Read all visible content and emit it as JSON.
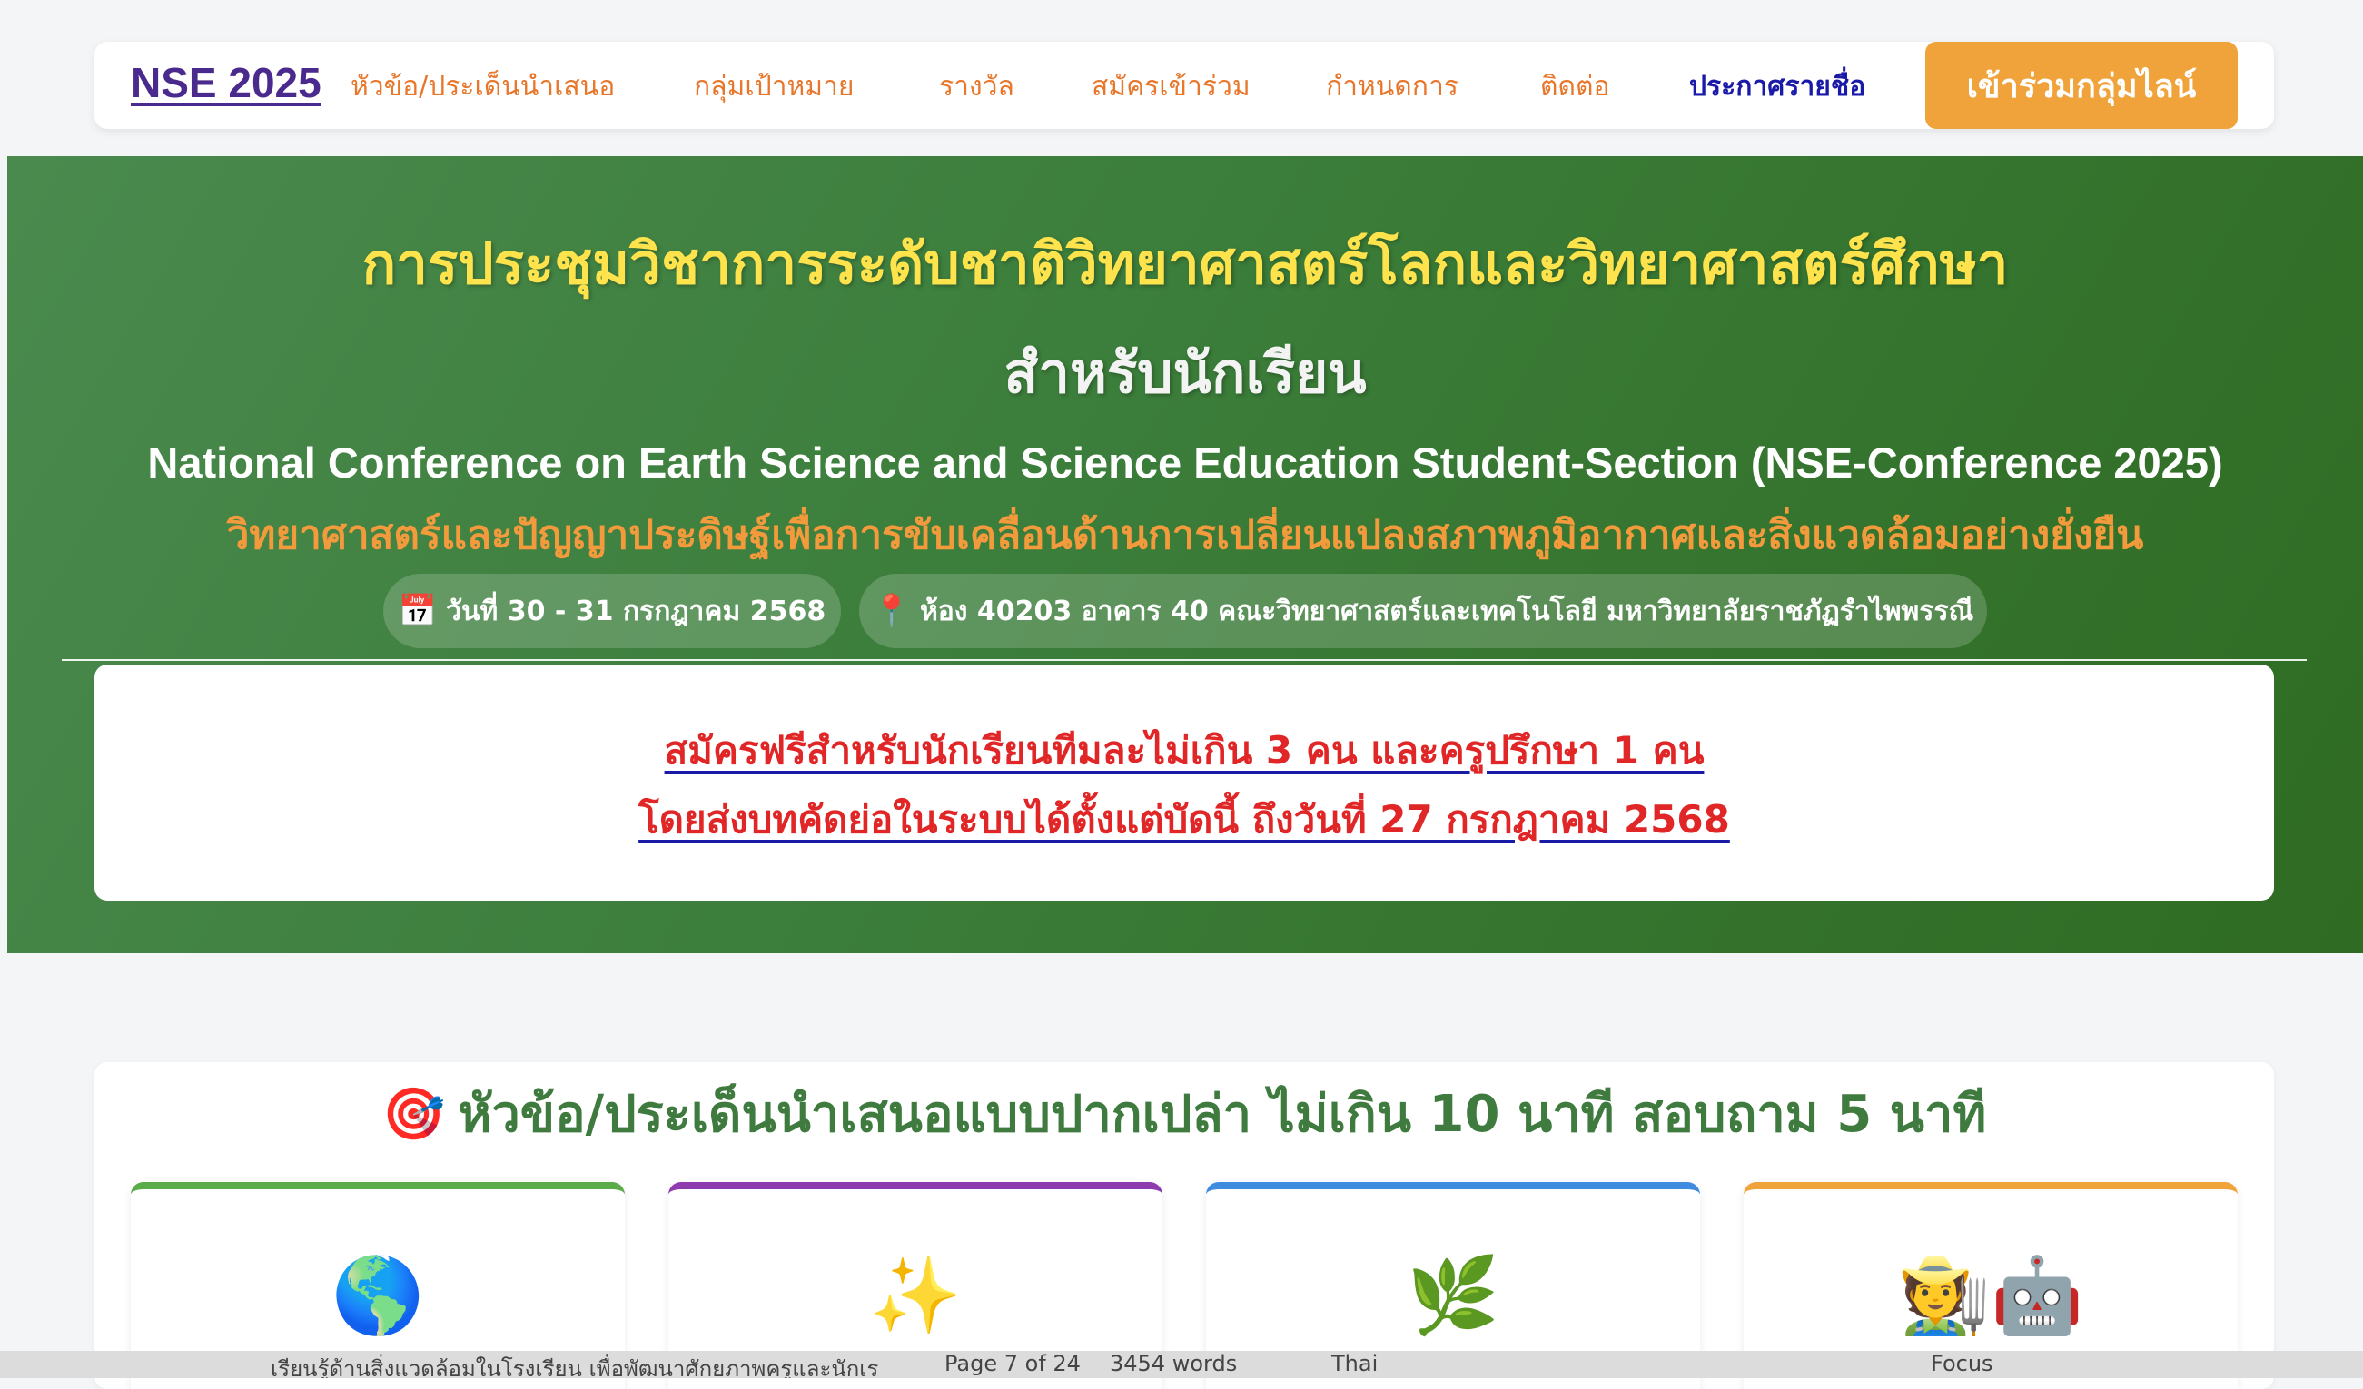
{
  "nav": {
    "brand": "NSE 2025",
    "links": [
      "หัวข้อ/ประเด็นนำเสนอ",
      "กลุ่มเป้าหมาย",
      "รางวัล",
      "สมัครเข้าร่วม",
      "กำหนดการ",
      "ติดต่อ",
      "ประกาศรายชื่อ"
    ],
    "cta": "เข้าร่วมกลุ่มไลน์"
  },
  "hero": {
    "title": "การประชุมวิชาการระดับชาติวิทยาศาสตร์โลกและวิทยาศาสตร์ศึกษา",
    "subtitle": "สำหรับนักเรียน",
    "english": "National Conference on Earth Science and Science Education Student-Section (NSE-Conference 2025)",
    "theme": "วิทยาศาสตร์และปัญญาประดิษฐ์เพื่อการขับเคลื่อนด้านการเปลี่ยนแปลงสภาพภูมิอากาศและสิ่งแวดล้อมอย่างยั่งยืน",
    "date": "วันที่ 30 - 31 กรกฎาคม 2568",
    "location": "ห้อง 40203 อาคาร 40 คณะวิทยาศาสตร์และเทคโนโลยี มหาวิทยาลัยราชภัฏรำไพพรรณี",
    "date_icon": "📅",
    "location_icon": "📍"
  },
  "notice": {
    "line1": "สมัครฟรีสำหรับนักเรียนทีมละไม่เกิน 3 คน และครูปรึกษา 1 คน",
    "line2": "โดยส่งบทคัดย่อในระบบได้ตั้งแต่บัดนี้ ถึงวันที่ 27 กรกฎาคม 2568"
  },
  "topics": {
    "icon": "🎯",
    "title": "หัวข้อ/ประเด็นนำเสนอแบบปากเปล่า ไม่เกิน 10 นาที สอบถาม 5 นาที",
    "cards": [
      {
        "emoji": "🌎",
        "accent": "#5aab4a"
      },
      {
        "emoji": "✨",
        "accent": "#8e3bb0"
      },
      {
        "emoji": "🌿",
        "accent": "#3f8be0"
      },
      {
        "emoji": "🧑‍🌾🤖",
        "accent": "#f0a33a"
      }
    ]
  },
  "taskbar": {
    "doc_text": "เรียนรู้ด้านสิ่งแวดล้อมในโรงเรียน เพื่อพัฒนาศักยภาพครูและนักเร",
    "page": "Page 7 of 24",
    "words": "3454 words",
    "lang": "Thai",
    "focus": "Focus"
  }
}
